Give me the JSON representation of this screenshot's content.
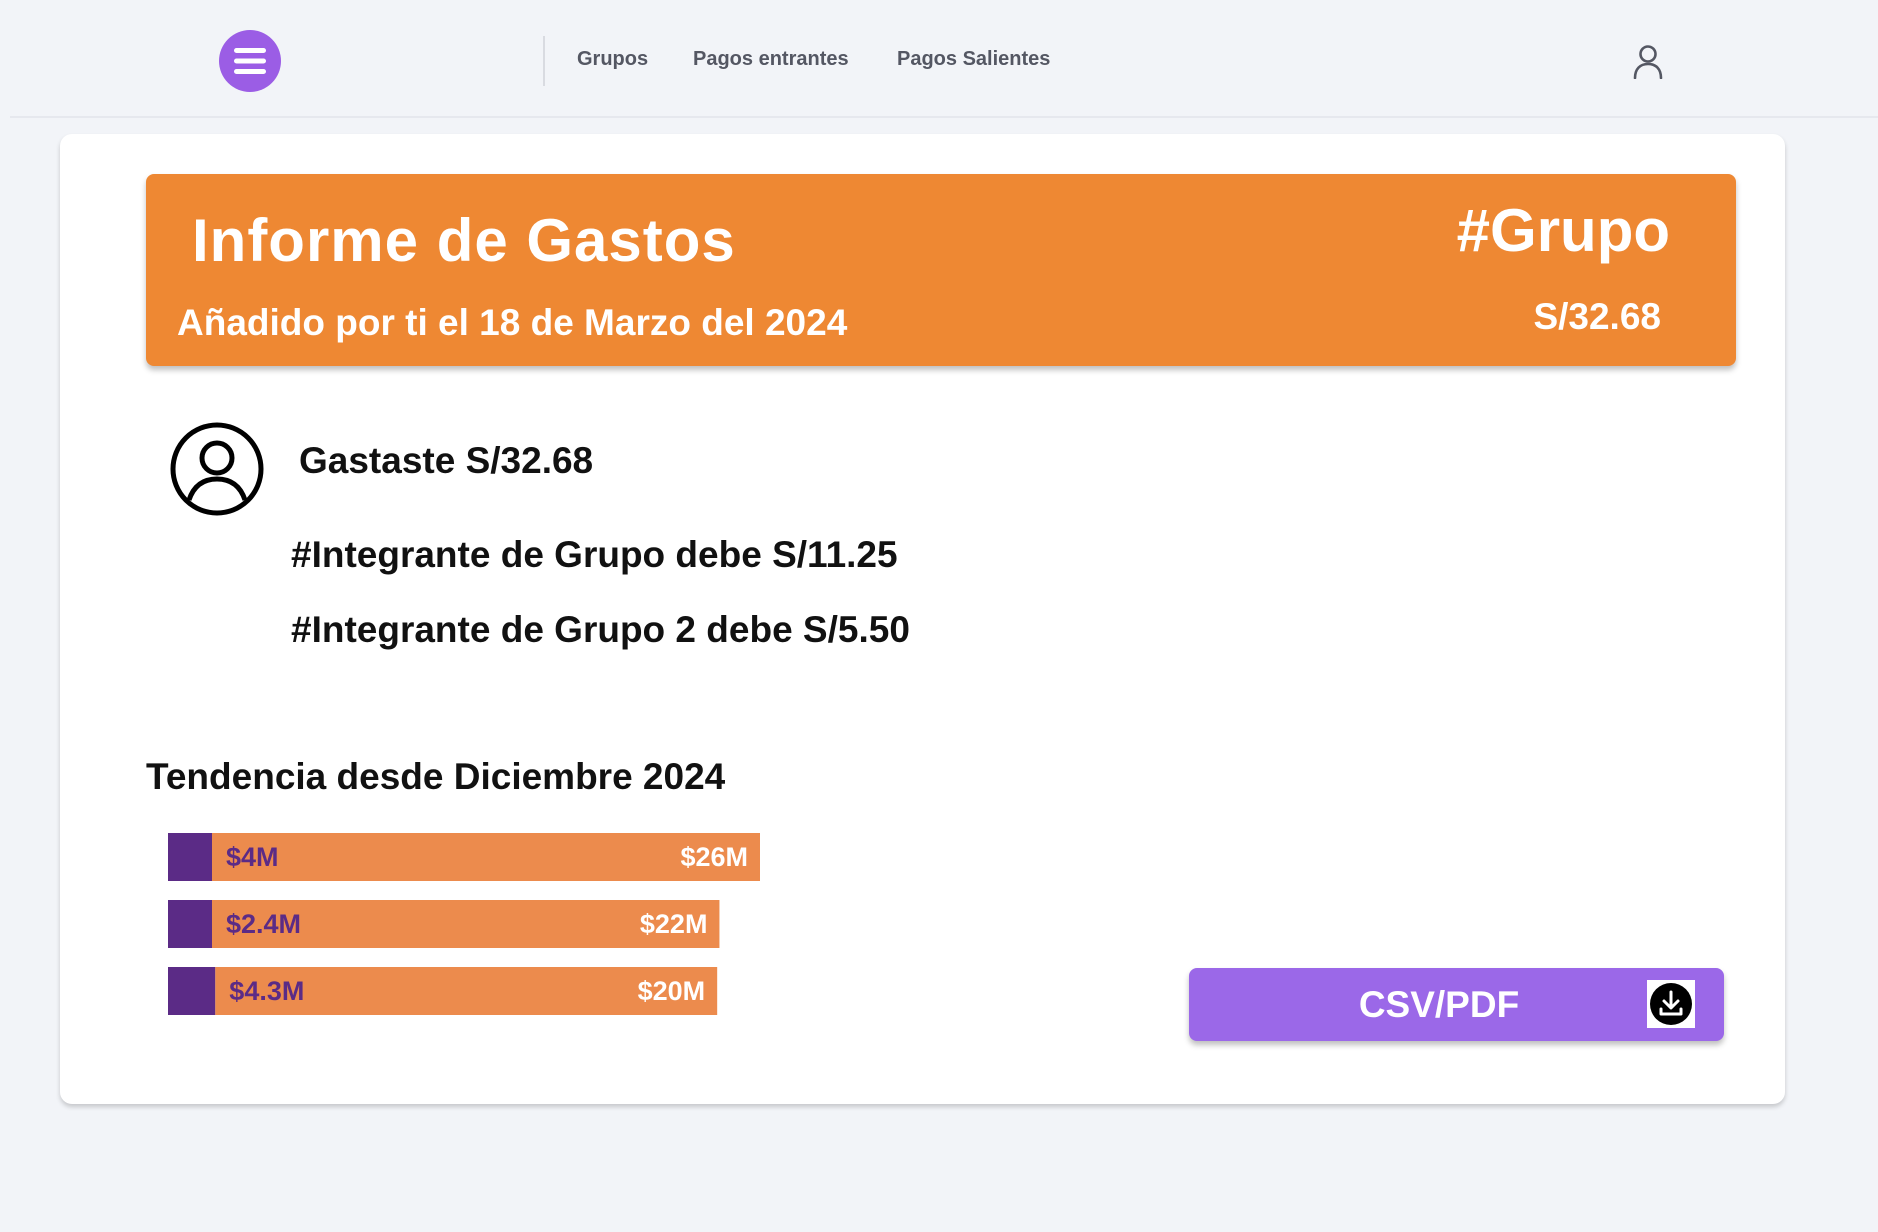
{
  "colors": {
    "accent_purple": "#9b5de5",
    "button_purple": "#9b68e8",
    "banner_orange": "#ee8833",
    "bar_orange": "#ec8b4d",
    "bar_purple": "#5b2b86"
  },
  "nav": {
    "menu_icon": "hamburger-icon",
    "links": [
      "Grupos",
      "Pagos entrantes",
      "Pagos Salientes"
    ],
    "user_icon": "user-icon"
  },
  "report": {
    "title": "Informe de Gastos",
    "added_line": "Añadido  por ti el 18 de Marzo del 2024",
    "group_tag": "#Grupo",
    "total": "S/32.68",
    "avatar_icon": "user-circle-icon",
    "spent_line": "Gastaste S/32.68",
    "debts": [
      "#Integrante de Grupo debe S/11.25",
      "#Integrante de Grupo 2 debe S/5.50"
    ]
  },
  "trend": {
    "title": "Tendencia desde Diciembre 2024"
  },
  "chart_data": {
    "type": "bar",
    "orientation": "horizontal",
    "stacked": true,
    "rows": [
      {
        "small": 4,
        "large": 26,
        "small_label": "$4M",
        "large_label": "$26M"
      },
      {
        "small": 2.4,
        "large": 22,
        "small_label": "$2.4M",
        "large_label": "$22M"
      },
      {
        "small": 4.3,
        "large": 20,
        "small_label": "$4.3M",
        "large_label": "$20M"
      }
    ]
  },
  "download": {
    "label": "CSV/PDF",
    "icon": "download-icon"
  }
}
